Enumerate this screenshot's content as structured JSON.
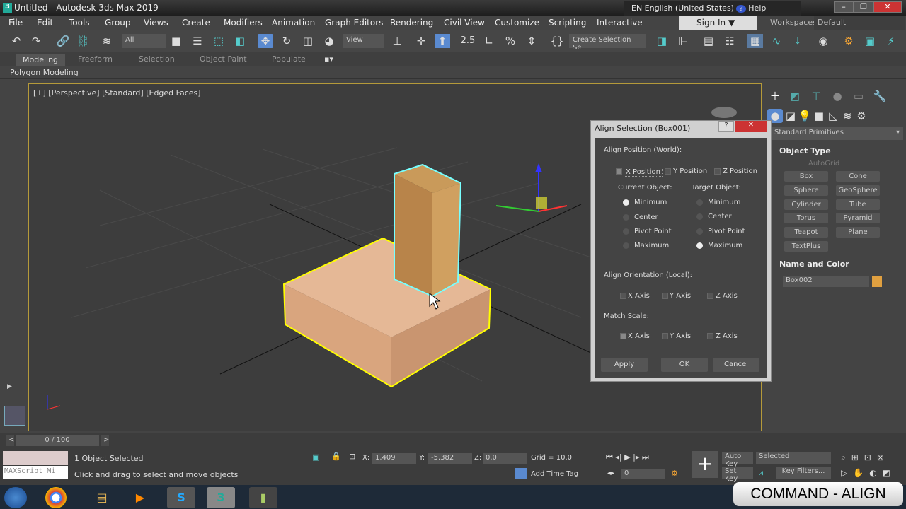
{
  "window": {
    "title": "Untitled - Autodesk 3ds Max 2019",
    "app_icon": "3",
    "language": "EN English (United States)",
    "help": "Help",
    "minimize": "–",
    "restore": "❐",
    "close": "✕"
  },
  "menu": [
    "File",
    "Edit",
    "Tools",
    "Group",
    "Views",
    "Create",
    "Modifiers",
    "Animation",
    "Graph Editors",
    "Rendering",
    "Civil View",
    "Customize",
    "Scripting",
    "Interactive"
  ],
  "signin": "Sign In",
  "workspaces_label": "Workspaces:",
  "workspace": "Default",
  "toolbar": {
    "filter": "All",
    "ref_coord": "View",
    "selection_set": "Create Selection Se",
    "snap_label": "2.5"
  },
  "ribbon": {
    "tabs": [
      "Modeling",
      "Freeform",
      "Selection",
      "Object Paint",
      "Populate"
    ],
    "sub": "Polygon Modeling"
  },
  "viewport": {
    "label": "[+] [Perspective] [Standard] [Edged Faces]",
    "colors": {
      "selected": "#ffff00",
      "target": "#7ff",
      "box": "#d9a57e",
      "column": "#b8844a"
    }
  },
  "command_panel": {
    "category": "Standard Primitives",
    "object_type": "Object Type",
    "autogrid": "AutoGrid",
    "buttons": [
      "Box",
      "Cone",
      "Sphere",
      "GeoSphere",
      "Cylinder",
      "Tube",
      "Torus",
      "Pyramid",
      "Teapot",
      "Plane",
      "TextPlus"
    ],
    "name_color": "Name and Color",
    "name": "Box002",
    "color": "#e0a040"
  },
  "dialog": {
    "title": "Align Selection (Box001)",
    "help": "?",
    "close": "✕",
    "align_position": "Align Position (World):",
    "x_pos": "X Position",
    "y_pos": "Y Position",
    "z_pos": "Z Position",
    "current": "Current Object:",
    "target": "Target Object:",
    "options": [
      "Minimum",
      "Center",
      "Pivot Point",
      "Maximum"
    ],
    "current_selected": "Minimum",
    "target_selected": "Maximum",
    "align_orient": "Align Orientation (Local):",
    "match_scale": "Match Scale:",
    "x_axis": "X Axis",
    "y_axis": "Y Axis",
    "z_axis": "Z Axis",
    "apply": "Apply",
    "ok": "OK",
    "cancel": "Cancel"
  },
  "timeline": {
    "frame": "0 / 100",
    "prev": "<",
    "next": ">"
  },
  "status": {
    "selected": "1 Object Selected",
    "prompt": "Click and drag to select and move objects",
    "maxscript": "MAXScript Mi",
    "x_label": "X:",
    "x": "1.409",
    "y_label": "Y:",
    "y": "-5.382",
    "z_label": "Z:",
    "z": "0.0",
    "grid": "Grid = 10.0",
    "time_tag": "Add Time Tag",
    "frame": "0",
    "auto_key": "Auto Key",
    "set_key": "Set Key",
    "key_mode": "Selected",
    "key_filters": "Key Filters..."
  },
  "overlay": "COMMAND - ALIGN"
}
